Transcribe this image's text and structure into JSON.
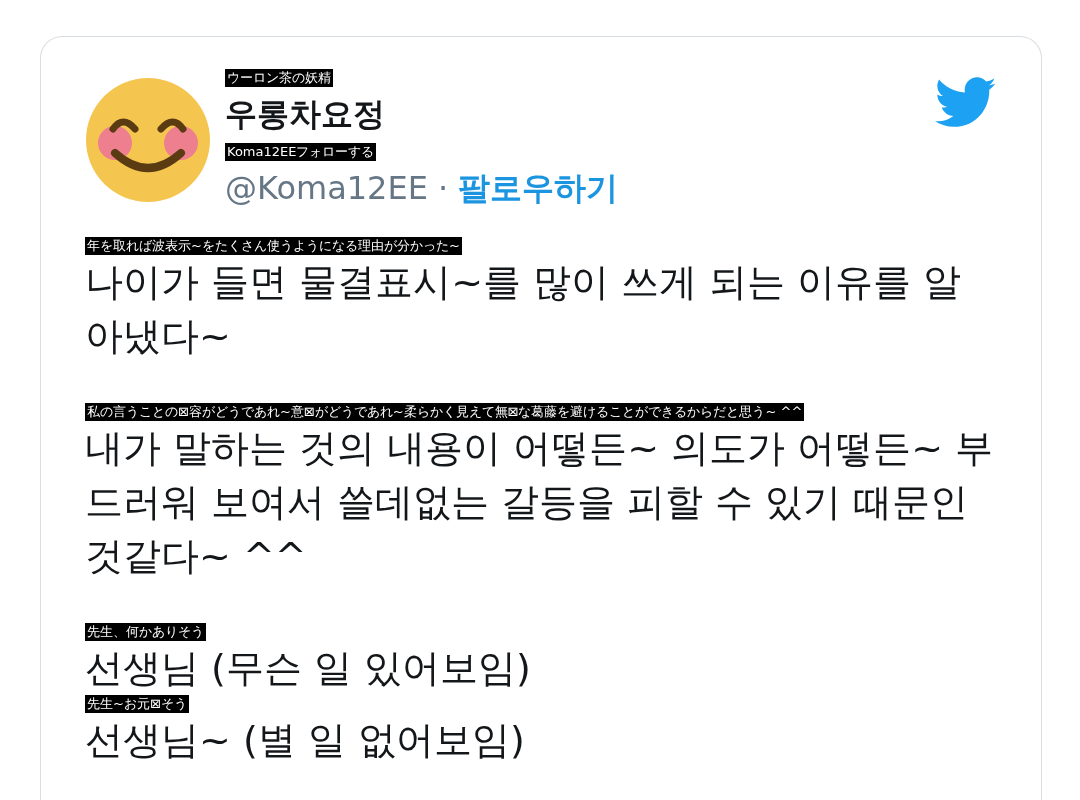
{
  "tweet": {
    "author": {
      "name": "우롱차요정",
      "name_translation": "ウーロン茶の妖精",
      "handle": "@Koma12EE",
      "handle_translation": "Koma12EEフォローする",
      "separator": "·",
      "follow": "팔로우하기"
    },
    "paragraphs": [
      {
        "lines": [
          {
            "text": "나이가 들면 물결표시~를 많이 쓰게 되는 이유를 알아냈다~",
            "translation": "年を取れば波表示~をたくさん使うようになる理由が分かった~"
          }
        ]
      },
      {
        "lines": [
          {
            "text": "내가 말하는 것의 내용이 어떻든~ 의도가 어떻든~ 부드러워 보여서 쓸데없는 갈등을 피할 수 있기 때문인 것같다~ ^^",
            "translation": "私の言うことの⊠容がどうであれ~意⊠がどうであれ~柔らかく見えて無⊠な葛藤を避けることができるからだと思う~ ^^"
          }
        ]
      },
      {
        "lines": [
          {
            "text": "선생님 (무슨 일 있어보임)",
            "translation": "先生、何かありそう"
          },
          {
            "text": "선생님~ (별 일 없어보임)",
            "translation": "先生~お元⊠そう"
          }
        ]
      }
    ]
  }
}
